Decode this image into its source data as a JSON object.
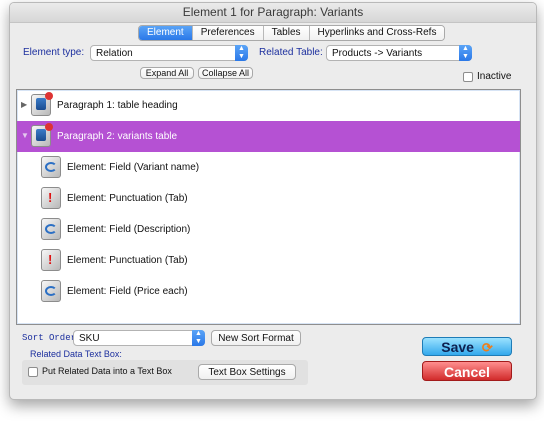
{
  "window": {
    "title": "Element 1 for Paragraph: Variants"
  },
  "tabs": [
    {
      "label": "Element",
      "active": true
    },
    {
      "label": "Preferences",
      "active": false
    },
    {
      "label": "Tables",
      "active": false
    },
    {
      "label": "Hyperlinks and Cross-Refs",
      "active": false
    }
  ],
  "element_type": {
    "label": "Element type:",
    "value": "Relation"
  },
  "related_table": {
    "label": "Related Table:",
    "value": "Products -> Variants"
  },
  "buttons": {
    "expand_all": "Expand All",
    "collapse_all": "Collapse All"
  },
  "inactive": {
    "label": "Inactive",
    "checked": false
  },
  "tree": {
    "items": [
      {
        "label": "Paragraph 1: table heading",
        "icon": "paragraph-icon",
        "selected": false
      },
      {
        "label": "Paragraph 2: variants table",
        "icon": "paragraph-icon",
        "selected": true
      },
      {
        "label": "Element: Field (Variant name)",
        "icon": "field-icon",
        "selected": false
      },
      {
        "label": "Element: Punctuation (Tab)",
        "icon": "punctuation-icon",
        "selected": false
      },
      {
        "label": "Element: Field (Description)",
        "icon": "field-icon",
        "selected": false
      },
      {
        "label": "Element: Punctuation (Tab)",
        "icon": "punctuation-icon",
        "selected": false
      },
      {
        "label": "Element: Field (Price each)",
        "icon": "field-icon",
        "selected": false
      }
    ]
  },
  "sort": {
    "label": "Sort Order:",
    "value": "SKU",
    "new_sort_button": "New Sort Format"
  },
  "related_data": {
    "heading": "Related Data Text Box:",
    "checkbox_label": "Put Related Data into a Text Box",
    "checked": false,
    "settings_button": "Text Box Settings"
  },
  "actions": {
    "save": "Save",
    "cancel": "Cancel"
  },
  "colors": {
    "selected_row": "#b551d3",
    "accent_blue": "#2a78e8",
    "save": "#33a8ec",
    "cancel": "#d12b2b"
  }
}
